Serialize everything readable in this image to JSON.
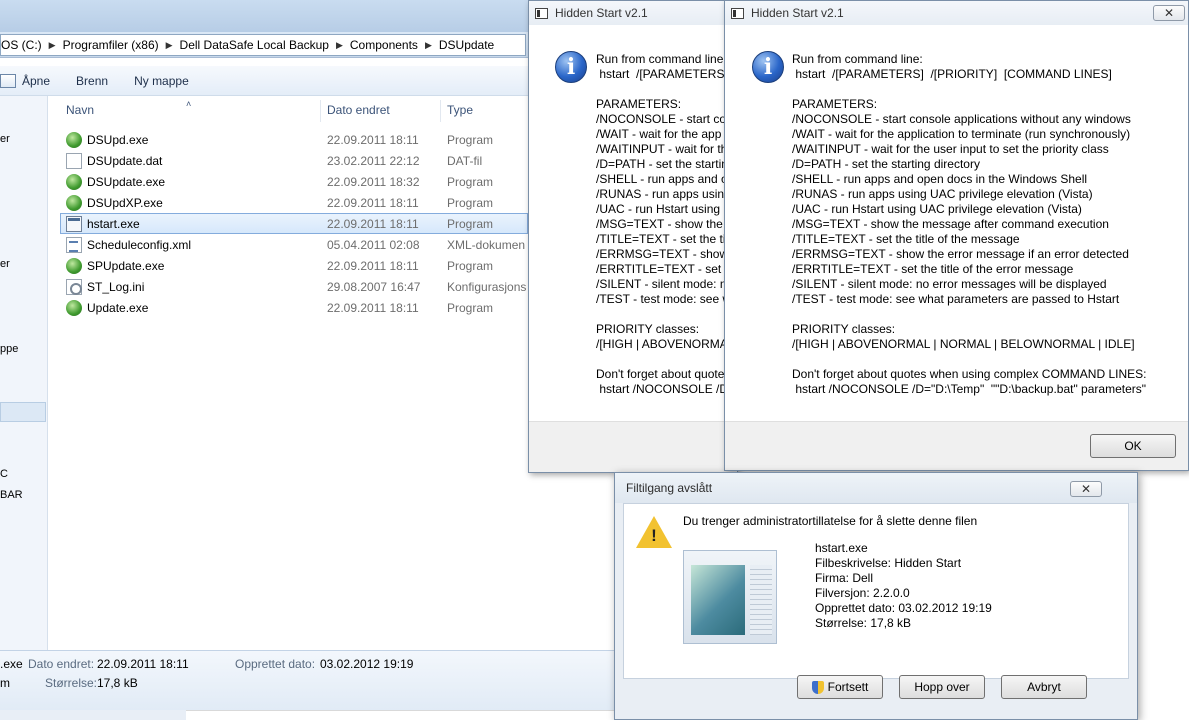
{
  "explorer": {
    "breadcrumb": [
      "OS (C:)",
      "Programfiler (x86)",
      "Dell DataSafe Local Backup",
      "Components",
      "DSUpdate"
    ],
    "toolbar": {
      "open": "Åpne",
      "burn": "Brenn",
      "new_folder": "Ny mappe"
    },
    "nav_fragments": [
      "er",
      "er",
      "ppe",
      "C",
      "BAR"
    ],
    "columns": {
      "name": "Navn",
      "date": "Dato endret",
      "type": "Type"
    },
    "files": [
      {
        "name": "DSUpd.exe",
        "date": "22.09.2011 18:11",
        "type": "Program",
        "icon": "program-icon"
      },
      {
        "name": "DSUpdate.dat",
        "date": "23.02.2011 22:12",
        "type": "DAT-fil",
        "icon": "file-icon"
      },
      {
        "name": "DSUpdate.exe",
        "date": "22.09.2011 18:32",
        "type": "Program",
        "icon": "program-icon"
      },
      {
        "name": "DSUpdXP.exe",
        "date": "22.09.2011 18:11",
        "type": "Program",
        "icon": "program-icon"
      },
      {
        "name": "hstart.exe",
        "date": "22.09.2011 18:11",
        "type": "Program",
        "icon": "window-app-icon",
        "selected": true
      },
      {
        "name": "Scheduleconfig.xml",
        "date": "05.04.2011 02:08",
        "type": "XML-dokumen",
        "icon": "xml-file-icon"
      },
      {
        "name": "SPUpdate.exe",
        "date": "22.09.2011 18:11",
        "type": "Program",
        "icon": "program-icon"
      },
      {
        "name": "ST_Log.ini",
        "date": "29.08.2007 16:47",
        "type": "Konfigurasjons",
        "icon": "settings-file-icon"
      },
      {
        "name": "Update.exe",
        "date": "22.09.2011 18:11",
        "type": "Program",
        "icon": "program-icon"
      }
    ],
    "details": {
      "name_fragment": ".exe",
      "type_fragment": "m",
      "modified_label": "Dato endret:",
      "modified_value": "22.09.2011 18:11",
      "created_label": "Opprettet dato:",
      "created_value": "03.02.2012 19:19",
      "size_label": "Størrelse:",
      "size_value": "17,8 kB"
    }
  },
  "hidden_start_back": {
    "title": "Hidden Start v2.1",
    "text": "Run from command line\n hstart  /[PARAMETERS]\n\nPARAMETERS:\n/NOCONSOLE - start co\n/WAIT - wait for the app\n/WAITINPUT - wait for th\n/D=PATH - set the startin\n/SHELL - run apps and o\n/RUNAS - run apps using\n/UAC - run Hstart using\n/MSG=TEXT - show the m\n/TITLE=TEXT - set the tit\n/ERRMSG=TEXT - show t\n/ERRTITLE=TEXT - set th\n/SILENT - silent mode: n\n/TEST - test mode: see w\n\nPRIORITY classes:\n/[HIGH | ABOVENORMAL\n\nDon't forget about quote\n hstart /NOCONSOLE /D="
  },
  "hidden_start_front": {
    "title": "Hidden Start v2.1",
    "close": "✕",
    "text": "Run from command line:\n hstart  /[PARAMETERS]  /[PRIORITY]  [COMMAND LINES]\n\nPARAMETERS:\n/NOCONSOLE - start console applications without any windows\n/WAIT - wait for the application to terminate (run synchronously)\n/WAITINPUT - wait for the user input to set the priority class\n/D=PATH - set the starting directory\n/SHELL - run apps and open docs in the Windows Shell\n/RUNAS - run apps using UAC privilege elevation (Vista)\n/UAC - run Hstart using UAC privilege elevation (Vista)\n/MSG=TEXT - show the message after command execution\n/TITLE=TEXT - set the title of the message\n/ERRMSG=TEXT - show the error message if an error detected\n/ERRTITLE=TEXT - set the title of the error message\n/SILENT - silent mode: no error messages will be displayed\n/TEST - test mode: see what parameters are passed to Hstart\n\nPRIORITY classes:\n/[HIGH | ABOVENORMAL | NORMAL | BELOWNORMAL | IDLE]\n\nDon't forget about quotes when using complex COMMAND LINES:\n hstart /NOCONSOLE /D=\"D:\\Temp\"  \"\"D:\\backup.bat\" parameters\"",
    "ok": "OK"
  },
  "access_denied": {
    "title": "Filtilgang avslått",
    "close": "✕",
    "message": "Du trenger administratortillatelse for å slette denne filen",
    "file_name": "hstart.exe",
    "description": "Filbeskrivelse: Hidden Start",
    "company": "Firma: Dell",
    "version": "Filversjon: 2.2.0.0",
    "created": "Opprettet dato: 03.02.2012 19:19",
    "size": "Størrelse: 17,8 kB",
    "buttons": {
      "continue": "Fortsett",
      "skip": "Hopp over",
      "cancel": "Avbryt"
    }
  }
}
